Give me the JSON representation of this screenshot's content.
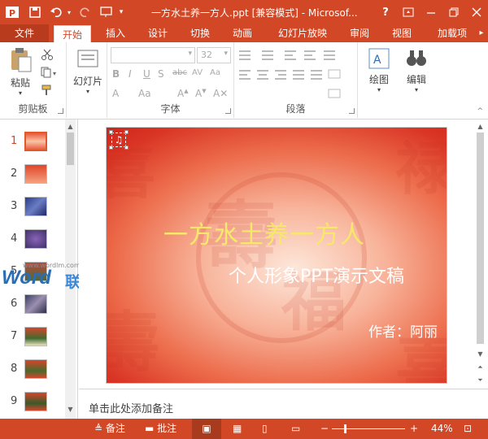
{
  "window": {
    "title": "一方水土养一方人.ppt [兼容模式] - Microsof...",
    "help": "?"
  },
  "tabs": [
    "文件",
    "开始",
    "插入",
    "设计",
    "切换",
    "动画",
    "幻灯片放映",
    "审阅",
    "视图",
    "加载项"
  ],
  "ribbon": {
    "clipboard": {
      "paste": "粘贴",
      "label": "剪贴板"
    },
    "slides": {
      "label": "幻灯片"
    },
    "font": {
      "size": "32",
      "label": "字体"
    },
    "paragraph": {
      "label": "段落"
    },
    "drawing": {
      "label": "绘图"
    },
    "editing": {
      "label": "编辑"
    }
  },
  "slide_numbers": [
    "1",
    "2",
    "3",
    "4",
    "5",
    "6",
    "7",
    "8",
    "9"
  ],
  "slide": {
    "title": "一方水土养一方人",
    "subtitle": "个人形象PPT演示文稿",
    "author": "作者：阿丽"
  },
  "watermark": {
    "url": "www.wordlm.com",
    "word": "Word",
    "brand": "联盟"
  },
  "notes_placeholder": "单击此处添加备注",
  "status": {
    "notes": "备注",
    "comments": "批注",
    "zoom": "44%"
  },
  "colors": {
    "accent": "#d24726",
    "title_yellow": "#f7e86a"
  }
}
